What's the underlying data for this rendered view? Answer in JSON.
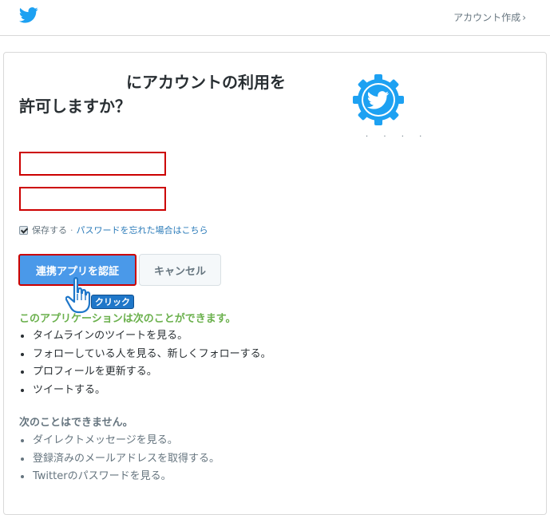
{
  "header": {
    "logo_icon": "twitter-bird-icon",
    "create_account_label": "アカウント作成",
    "chevron": "›"
  },
  "auth": {
    "title_line1": "にアカウントの利用を",
    "title_line2": "許可しますか？",
    "app_icon": "twitter-gear-app-icon",
    "app_name_dots": "· · · ·"
  },
  "form": {
    "username_value": "",
    "password_value": "",
    "remember_checked": true,
    "remember_label": "保存する",
    "separator": "·",
    "forgot_link": "パスワードを忘れた場合はこちら",
    "authorize_button": "連携アプリを認証",
    "cancel_button": "キャンセル"
  },
  "annotation": {
    "click_label": "クリック",
    "hand_icon": "pointing-hand-cursor-icon"
  },
  "permissions": {
    "can_heading": "このアプリケーションは次のことができます。",
    "can_items": [
      "タイムラインのツイートを見る。",
      "フォローしている人を見る、新しくフォローする。",
      "プロフィールを更新する。",
      "ツイートする。"
    ],
    "cannot_heading": "次のことはできません。",
    "cannot_items": [
      "ダイレクトメッセージを見る。",
      "登録済みのメールアドレスを取得する。",
      "Twitterのパスワードを見る。"
    ]
  },
  "colors": {
    "twitter_blue": "#1da1f2",
    "button_blue": "#4a99e9",
    "highlight_red": "#cc0000",
    "can_heading_green": "#6ab04c"
  }
}
